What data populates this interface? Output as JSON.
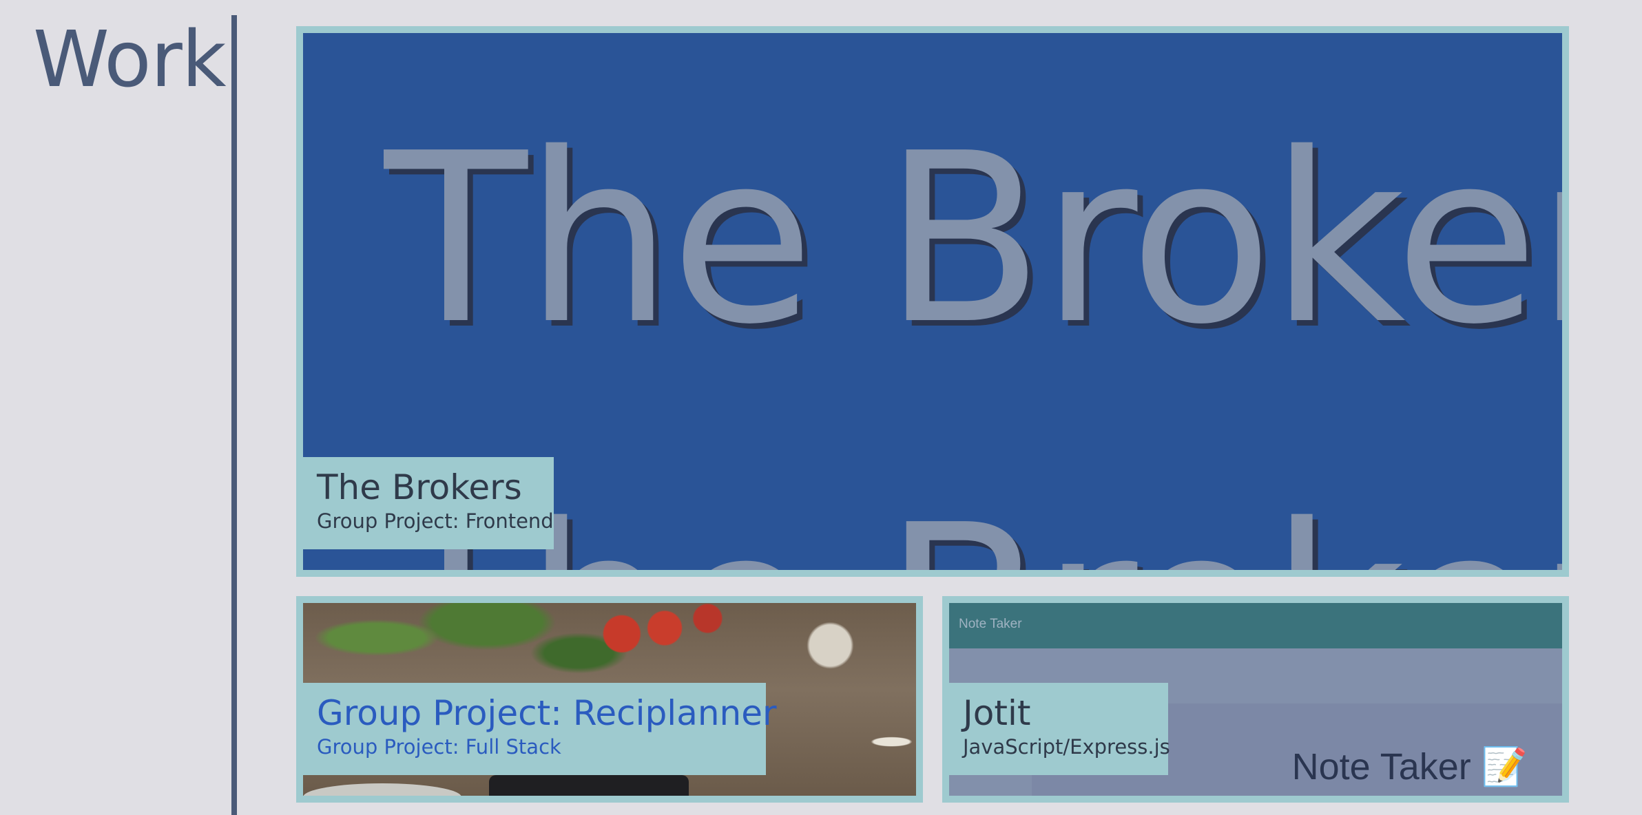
{
  "section": {
    "title": "Work"
  },
  "projects": [
    {
      "title": "The Brokers",
      "subtitle": "Group Project: Frontend",
      "thumb_text": "The Brokers"
    },
    {
      "title": "Group Project: Reciplanner",
      "subtitle": "Group Project: Full Stack"
    },
    {
      "title": "Jotit",
      "subtitle": "JavaScript/Express.js",
      "thumb_header": "Note Taker",
      "thumb_footer": "Note Taker 📝"
    }
  ],
  "colors": {
    "background": "#e0dfe4",
    "accent": "#4a5a78",
    "card_border": "#9ecacf",
    "link": "#2a5bbf"
  }
}
